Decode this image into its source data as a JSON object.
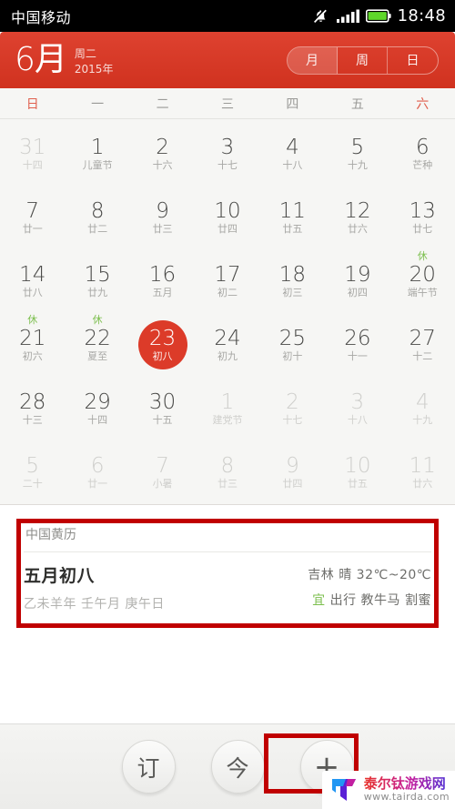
{
  "statusbar": {
    "carrier": "中国移动",
    "clock": "18:48",
    "icons": [
      "mute-bell-icon",
      "signal-bars-icon",
      "battery-icon"
    ]
  },
  "header": {
    "month": "6月",
    "weekday": "周二",
    "year": "2015年",
    "views": [
      {
        "label": "月",
        "active": true
      },
      {
        "label": "周",
        "active": false
      },
      {
        "label": "日",
        "active": false
      }
    ],
    "accent_color": "#d0321f"
  },
  "weekdays": [
    {
      "label": "日",
      "weekend": true
    },
    {
      "label": "一",
      "weekend": false
    },
    {
      "label": "二",
      "weekend": false
    },
    {
      "label": "三",
      "weekend": false
    },
    {
      "label": "四",
      "weekend": false
    },
    {
      "label": "五",
      "weekend": false
    },
    {
      "label": "六",
      "weekend": true
    }
  ],
  "calendar": {
    "selected_day": "23",
    "selected_color": "#dc3b29",
    "rest_color": "#7cbf4e",
    "days": [
      {
        "num": "31",
        "lunar": "十四",
        "out": true,
        "rest": false,
        "today": false
      },
      {
        "num": "1",
        "lunar": "儿童节",
        "out": false,
        "rest": false,
        "today": false
      },
      {
        "num": "2",
        "lunar": "十六",
        "out": false,
        "rest": false,
        "today": false
      },
      {
        "num": "3",
        "lunar": "十七",
        "out": false,
        "rest": false,
        "today": false
      },
      {
        "num": "4",
        "lunar": "十八",
        "out": false,
        "rest": false,
        "today": false
      },
      {
        "num": "5",
        "lunar": "十九",
        "out": false,
        "rest": false,
        "today": false
      },
      {
        "num": "6",
        "lunar": "芒种",
        "out": false,
        "rest": false,
        "today": false
      },
      {
        "num": "7",
        "lunar": "廿一",
        "out": false,
        "rest": false,
        "today": false
      },
      {
        "num": "8",
        "lunar": "廿二",
        "out": false,
        "rest": false,
        "today": false
      },
      {
        "num": "9",
        "lunar": "廿三",
        "out": false,
        "rest": false,
        "today": false
      },
      {
        "num": "10",
        "lunar": "廿四",
        "out": false,
        "rest": false,
        "today": false
      },
      {
        "num": "11",
        "lunar": "廿五",
        "out": false,
        "rest": false,
        "today": false
      },
      {
        "num": "12",
        "lunar": "廿六",
        "out": false,
        "rest": false,
        "today": false
      },
      {
        "num": "13",
        "lunar": "廿七",
        "out": false,
        "rest": false,
        "today": false
      },
      {
        "num": "14",
        "lunar": "廿八",
        "out": false,
        "rest": false,
        "today": false
      },
      {
        "num": "15",
        "lunar": "廿九",
        "out": false,
        "rest": false,
        "today": false
      },
      {
        "num": "16",
        "lunar": "五月",
        "out": false,
        "rest": false,
        "today": false
      },
      {
        "num": "17",
        "lunar": "初二",
        "out": false,
        "rest": false,
        "today": false
      },
      {
        "num": "18",
        "lunar": "初三",
        "out": false,
        "rest": false,
        "today": false
      },
      {
        "num": "19",
        "lunar": "初四",
        "out": false,
        "rest": false,
        "today": false
      },
      {
        "num": "20",
        "lunar": "端午节",
        "out": false,
        "rest": true,
        "today": false
      },
      {
        "num": "21",
        "lunar": "初六",
        "out": false,
        "rest": true,
        "today": false
      },
      {
        "num": "22",
        "lunar": "夏至",
        "out": false,
        "rest": true,
        "today": false
      },
      {
        "num": "23",
        "lunar": "初八",
        "out": false,
        "rest": false,
        "today": true
      },
      {
        "num": "24",
        "lunar": "初九",
        "out": false,
        "rest": false,
        "today": false
      },
      {
        "num": "25",
        "lunar": "初十",
        "out": false,
        "rest": false,
        "today": false
      },
      {
        "num": "26",
        "lunar": "十一",
        "out": false,
        "rest": false,
        "today": false
      },
      {
        "num": "27",
        "lunar": "十二",
        "out": false,
        "rest": false,
        "today": false
      },
      {
        "num": "28",
        "lunar": "十三",
        "out": false,
        "rest": false,
        "today": false
      },
      {
        "num": "29",
        "lunar": "十四",
        "out": false,
        "rest": false,
        "today": false
      },
      {
        "num": "30",
        "lunar": "十五",
        "out": false,
        "rest": false,
        "today": false
      },
      {
        "num": "1",
        "lunar": "建党节",
        "out": true,
        "rest": false,
        "today": false
      },
      {
        "num": "2",
        "lunar": "十七",
        "out": true,
        "rest": false,
        "today": false
      },
      {
        "num": "3",
        "lunar": "十八",
        "out": true,
        "rest": false,
        "today": false
      },
      {
        "num": "4",
        "lunar": "十九",
        "out": true,
        "rest": false,
        "today": false
      },
      {
        "num": "5",
        "lunar": "二十",
        "out": true,
        "rest": false,
        "today": false
      },
      {
        "num": "6",
        "lunar": "廿一",
        "out": true,
        "rest": false,
        "today": false
      },
      {
        "num": "7",
        "lunar": "小暑",
        "out": true,
        "rest": false,
        "today": false
      },
      {
        "num": "8",
        "lunar": "廿三",
        "out": true,
        "rest": false,
        "today": false
      },
      {
        "num": "9",
        "lunar": "廿四",
        "out": true,
        "rest": false,
        "today": false
      },
      {
        "num": "10",
        "lunar": "廿五",
        "out": true,
        "rest": false,
        "today": false
      },
      {
        "num": "11",
        "lunar": "廿六",
        "out": true,
        "rest": false,
        "today": false
      }
    ]
  },
  "info_card": {
    "title": "中国黄历",
    "lunar_date": "五月初八",
    "ganzhi": "乙未羊年 壬午月 庚午日",
    "weather": "吉林 晴 32℃~20℃",
    "yi_tag": "宜",
    "yi_items": "出行 教牛马 割蜜",
    "yi_color": "#7cbf4e"
  },
  "toolbar": {
    "buttons": [
      {
        "label": "订",
        "name": "subscribe-button"
      },
      {
        "label": "今",
        "name": "today-button"
      },
      {
        "label": "+",
        "name": "add-event-button"
      }
    ]
  },
  "annotations": [
    {
      "name": "annotation-info-card",
      "color": "#c00000"
    },
    {
      "name": "annotation-add-button",
      "color": "#c00000"
    }
  ],
  "watermark": {
    "name": "泰尔钛游戏网",
    "url": "www.tairda.com"
  }
}
